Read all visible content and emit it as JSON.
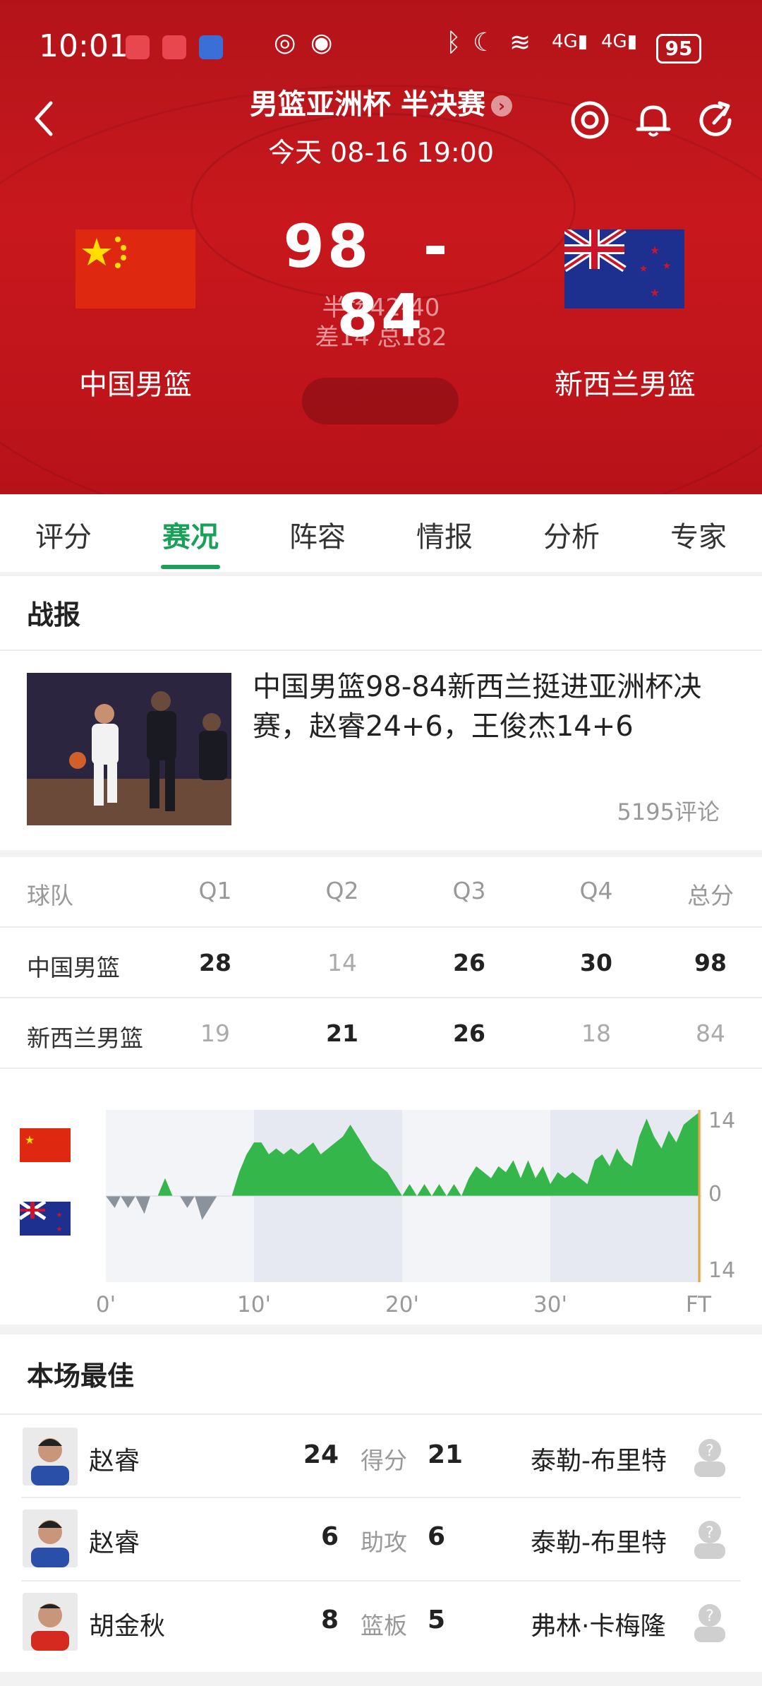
{
  "status_bar": {
    "time": "10:01",
    "signal1": "4G",
    "signal2": "4G",
    "battery": "95"
  },
  "header": {
    "title": "男篮亚洲杯 半决赛",
    "datetime": "今天 08-16 19:00"
  },
  "match": {
    "home_team": "中国男篮",
    "away_team": "新西兰男篮",
    "home_score": "98",
    "away_score": "84",
    "separator": "-",
    "halftime": "半场42-40",
    "diff_total": "差14 总182"
  },
  "tabs": [
    "评分",
    "赛况",
    "阵容",
    "情报",
    "分析",
    "专家"
  ],
  "active_tab": "赛况",
  "report": {
    "section_title": "战报",
    "headline": "中国男篮98-84新西兰挺进亚洲杯决赛，赵睿24+6，王俊杰14+6",
    "comments": "5195评论"
  },
  "quarter_table": {
    "headers": [
      "球队",
      "Q1",
      "Q2",
      "Q3",
      "Q4",
      "总分"
    ],
    "rows": [
      {
        "team": "中国男篮",
        "scores": [
          "28",
          "14",
          "26",
          "30",
          "98"
        ]
      },
      {
        "team": "新西兰男篮",
        "scores": [
          "19",
          "21",
          "26",
          "18",
          "84"
        ]
      }
    ]
  },
  "momentum_chart": {
    "y_labels": [
      "14",
      "0",
      "14"
    ],
    "x_labels": [
      "0'",
      "10'",
      "20'",
      "30'",
      "FT"
    ]
  },
  "chart_data": {
    "type": "area",
    "title": "",
    "xlabel": "",
    "ylabel": "",
    "x_ticks": [
      "0'",
      "10'",
      "20'",
      "30'",
      "FT"
    ],
    "ylim": [
      -14,
      14
    ],
    "series": [
      {
        "x": [
          0,
          0.6,
          1.0,
          1.5,
          2.0,
          2.6,
          3.0,
          3.5,
          4.0,
          4.5,
          5.0,
          5.5,
          6.0,
          6.5,
          7.0,
          7.5,
          8.0,
          8.5,
          9.0,
          9.5,
          10.0,
          10.5,
          11.0,
          11.5,
          12.0,
          12.5,
          13.0,
          13.5,
          14.0,
          14.5,
          15.0,
          15.5,
          16.0,
          16.5,
          17.0,
          17.5,
          18.0,
          18.5,
          19.0,
          19.5,
          20.0,
          20.5,
          21.0,
          21.5,
          22.0,
          22.5,
          23.0,
          23.5,
          24.0,
          24.5,
          25.0,
          25.5,
          26.0,
          26.5,
          27.0,
          27.5,
          28.0,
          28.5,
          29.0,
          29.5,
          30.0,
          30.5,
          31.0,
          31.5,
          32.0,
          32.5,
          33.0,
          33.5,
          34.0,
          34.5,
          35.0,
          35.5,
          36.0,
          36.5,
          37.0,
          37.5,
          38.0,
          38.5,
          39.0,
          39.5,
          40.0
        ],
        "values": [
          0,
          -2,
          0,
          -2,
          0,
          -3,
          0,
          0,
          3,
          0,
          0,
          -2,
          0,
          -4,
          -2,
          0,
          0,
          0,
          4,
          7,
          9,
          9,
          7,
          8,
          7,
          8,
          7,
          8,
          9,
          7,
          8,
          9,
          10,
          12,
          10,
          8,
          6,
          5,
          4,
          2,
          0,
          2,
          0,
          2,
          0,
          2,
          0,
          2,
          0,
          3,
          5,
          4,
          3,
          5,
          4,
          6,
          3,
          6,
          3,
          5,
          2,
          4,
          3,
          4,
          3,
          2,
          6,
          7,
          5,
          8,
          6,
          5,
          10,
          13,
          10,
          8,
          11,
          9,
          12,
          13,
          14
        ]
      }
    ]
  },
  "best": {
    "section_title": "本场最佳",
    "rows": [
      {
        "left_name": "赵睿",
        "left_value": "24",
        "stat": "得分",
        "right_value": "21",
        "right_name": "泰勒-布里特"
      },
      {
        "left_name": "赵睿",
        "left_value": "6",
        "stat": "助攻",
        "right_value": "6",
        "right_name": "泰勒-布里特"
      },
      {
        "left_name": "胡金秋",
        "left_value": "8",
        "stat": "篮板",
        "right_value": "5",
        "right_name": "弗林·卡梅隆"
      }
    ]
  },
  "colors": {
    "header_red": "#c8181d",
    "accent_green": "#1aa05a",
    "chart_green": "#35b64a",
    "chart_gray": "#8a929c",
    "chart_end_line": "#e8a33a"
  }
}
